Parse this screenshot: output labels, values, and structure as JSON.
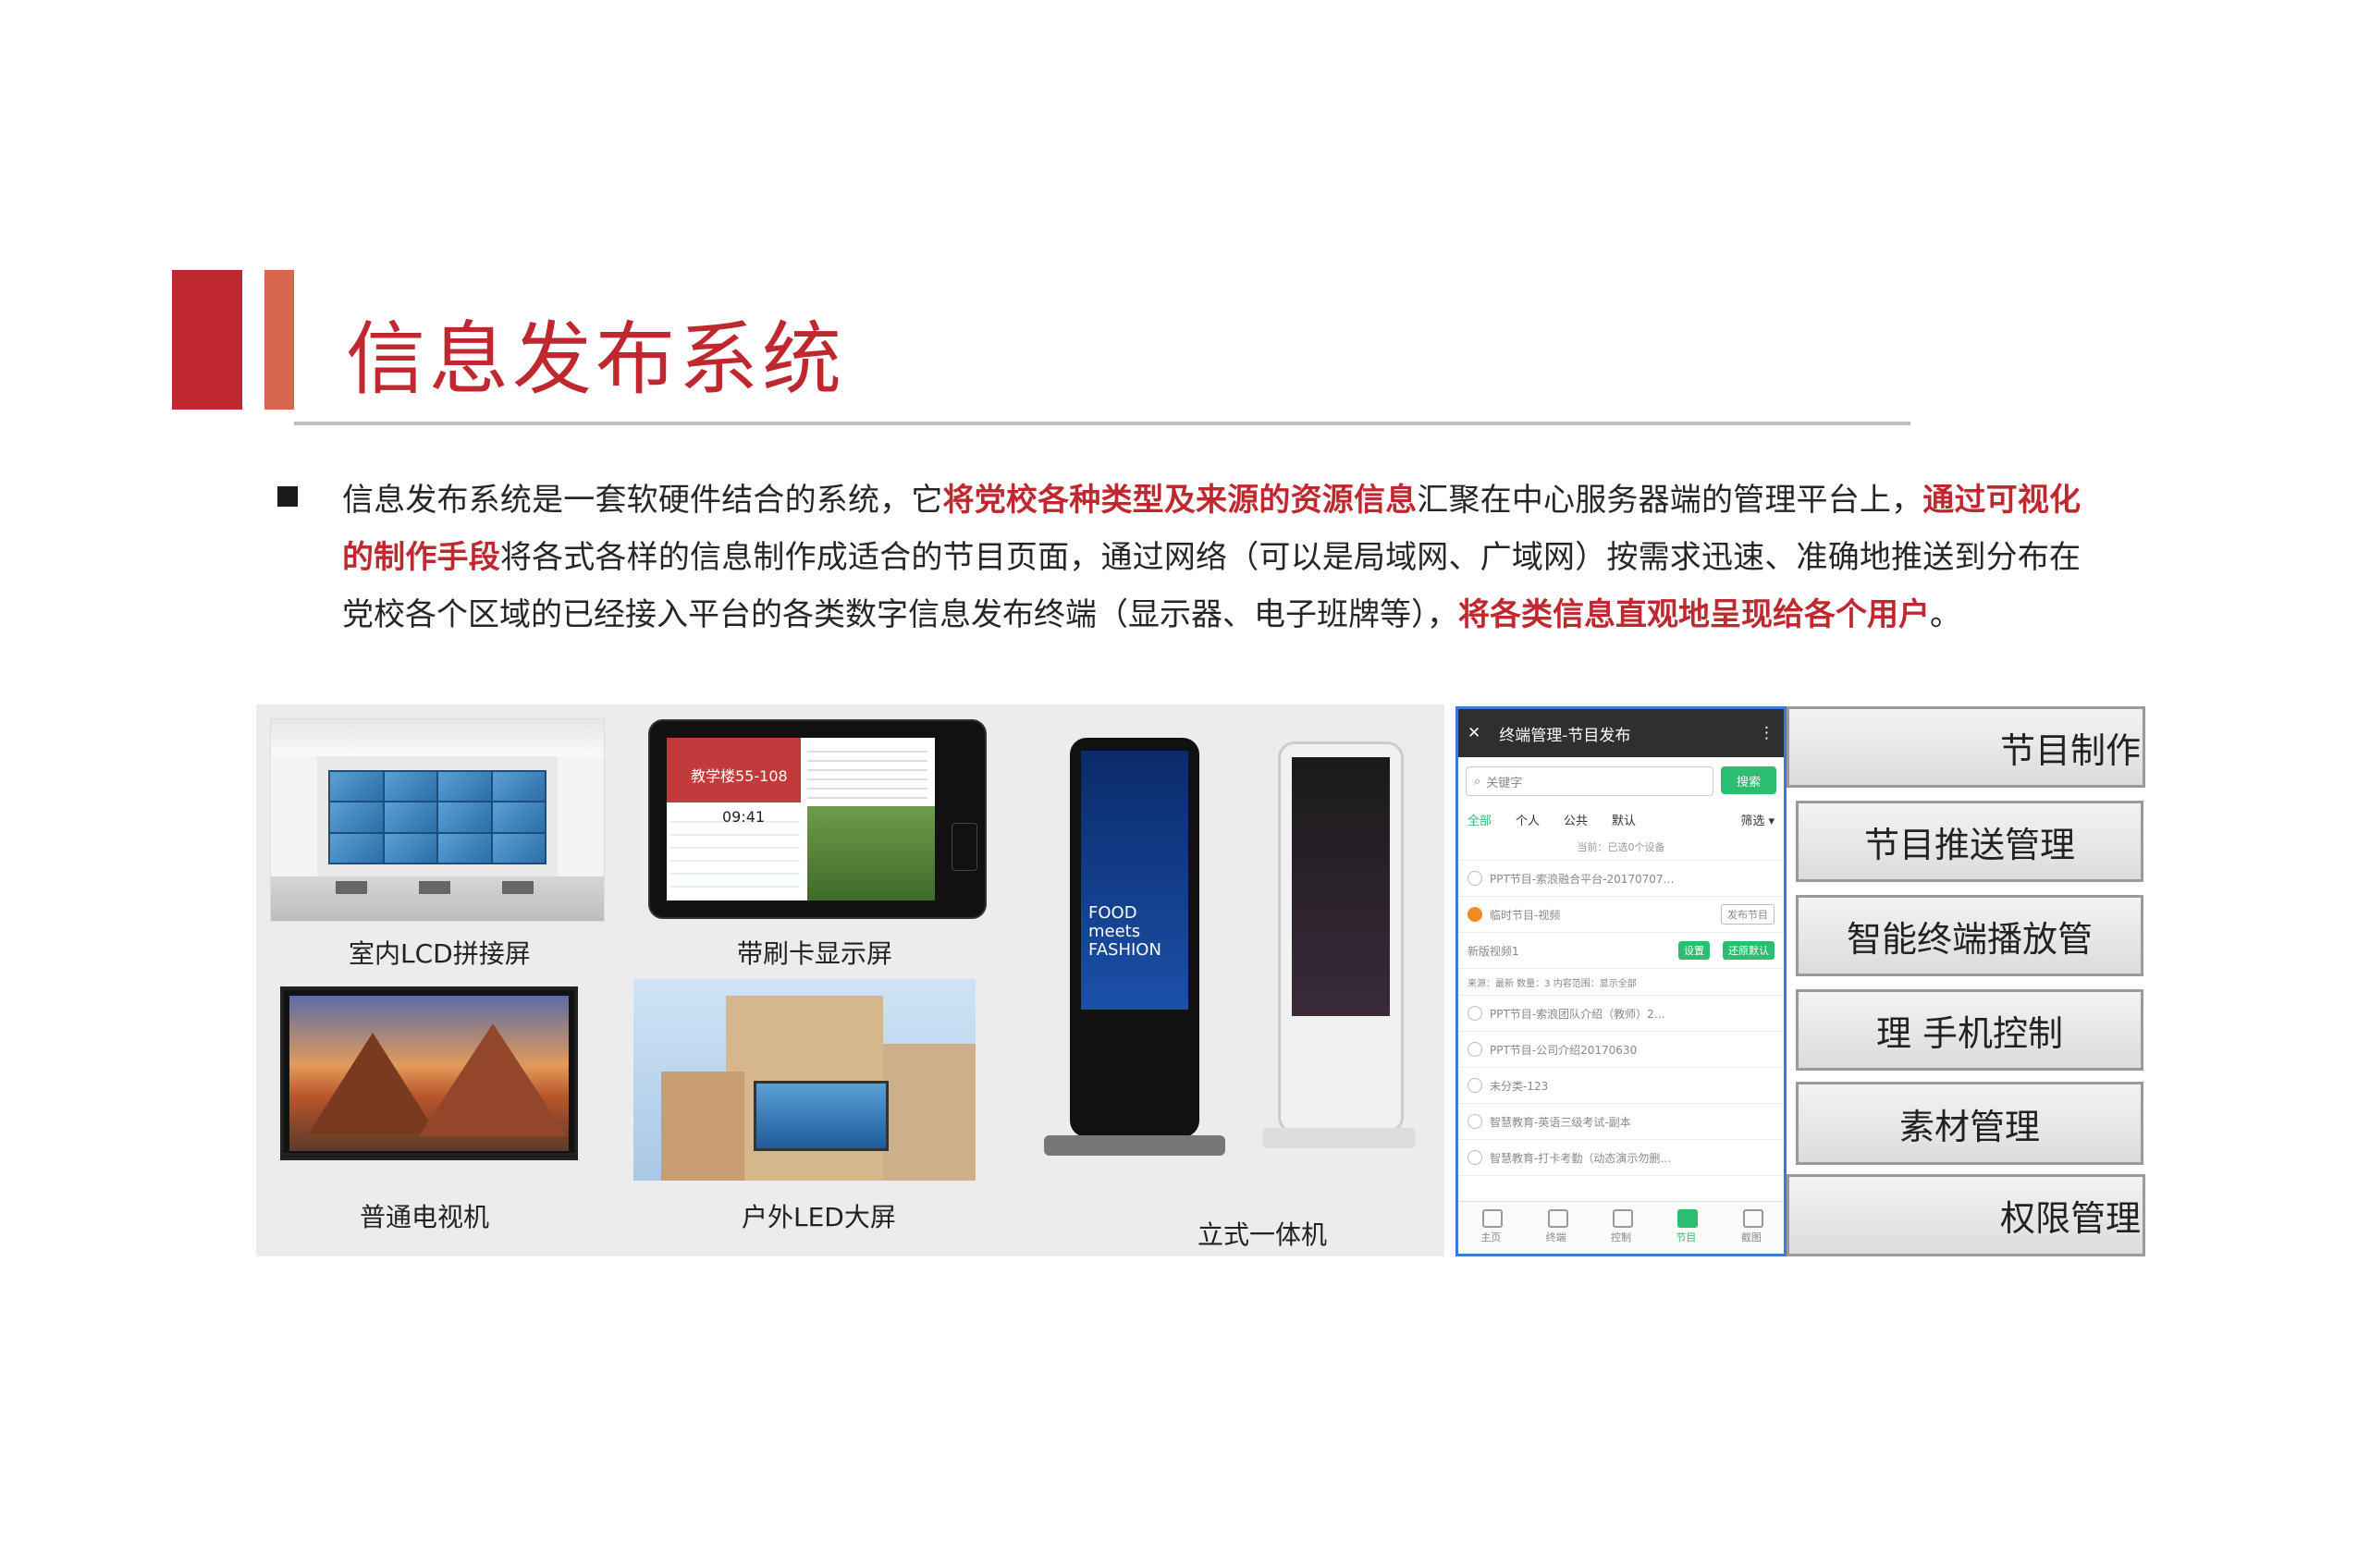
{
  "header": {
    "title": "信息发布系统"
  },
  "intro": {
    "segments": [
      {
        "text": "信息发布系统是一套软硬件结合的系统，它",
        "hl": false
      },
      {
        "text": "将党校各种类型及来源的资源信息",
        "hl": true
      },
      {
        "text": "汇聚在中心服务器端的管理平台上，",
        "hl": false
      },
      {
        "text": "通过可视化的制作手段",
        "hl": true
      },
      {
        "text": "将各式各样的信息制作成适合的节目页面，通过网络（可以是局域网、广域网）按需求迅速、准确地推送到分布在党校各个区域的已经接入平台的各类数字信息发布终端（显示器、电子班牌等），",
        "hl": false
      },
      {
        "text": "将各类信息直观地呈现给各个用户",
        "hl": true
      },
      {
        "text": "。",
        "hl": false
      }
    ]
  },
  "devices": {
    "lcd": "室内LCD拼接屏",
    "card": "带刷卡显示屏",
    "tv": "普通电视机",
    "outdoor": "户外LED大屏",
    "kiosk": "立式一体机",
    "card_screen_text": "教学楼55-108",
    "card_time": "09:41",
    "kiosk_word": "FOOD meets FASHION"
  },
  "phone": {
    "title": "终端管理-节目发布",
    "search_placeholder": "关键字",
    "search_btn": "搜索",
    "tabs": [
      "全部",
      "个人",
      "公共",
      "默认"
    ],
    "filter": "筛选 ▾",
    "hint": "当前：已选0个设备",
    "items": [
      "PPT节目-索浪融合平台-20170707…",
      "临时节目-视频",
      "新版视频1",
      "来源：最新 数量：3 内容范围：显示全部",
      "PPT节目-索浪团队介绍（教师）2…",
      "PPT节目-公司介绍20170630",
      "未分类-123",
      "智慧教育-英语三级考试-副本",
      "智慧教育-打卡考勤（动态演示勿删…"
    ],
    "publish_btn": "发布节目",
    "set_btn": "设置",
    "restore_btn": "还原默认",
    "nav": [
      "主页",
      "终端",
      "控制",
      "节目",
      "截图"
    ]
  },
  "features": {
    "f1": "节目制作",
    "f2": "节目推送管理",
    "f3": "智能终端播放管",
    "f4": "理 手机控制",
    "f5": "素材管理",
    "f6": "权限管理"
  },
  "colors": {
    "accent": "#c0282f",
    "accent2": "#d9664f",
    "green": "#2bbd70"
  }
}
